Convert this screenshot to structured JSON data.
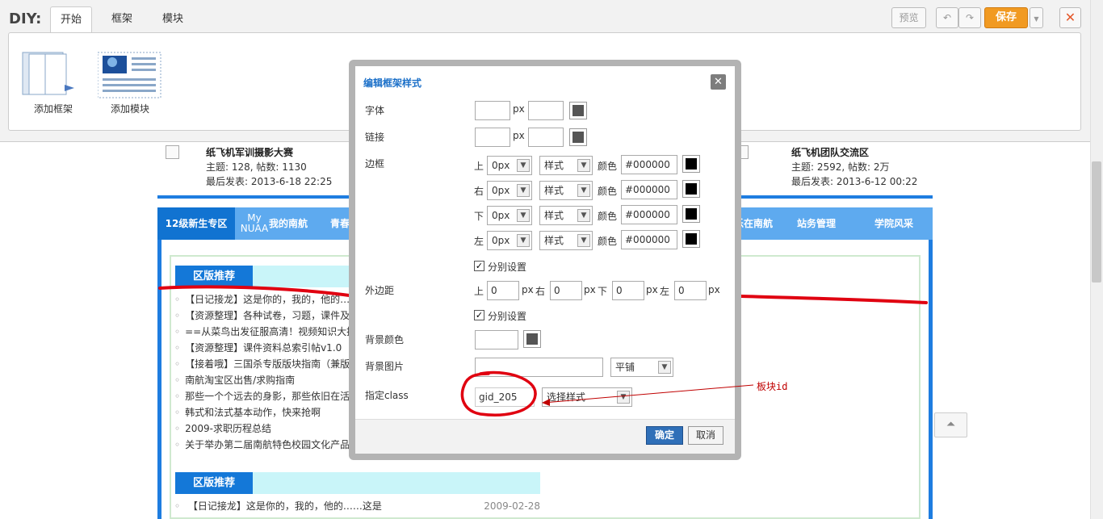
{
  "diy": {
    "label": "DIY:",
    "tabs": [
      "开始",
      "框架",
      "模块"
    ],
    "tools": {
      "add_frame": "添加框架",
      "add_module": "添加模块"
    },
    "preview": "预览",
    "undo_icon": "undo-icon",
    "redo_icon": "redo-icon",
    "save": "保存",
    "close": "✕"
  },
  "forum": {
    "left": {
      "title": "纸飞机军训摄影大赛",
      "stats": "主题: 128, 帖数: 1130",
      "last": "最后发表: 2013-6-18 22:25"
    },
    "right": {
      "title": "纸飞机团队交流区",
      "stats": "主题: 2592, 帖数: 2万",
      "last": "最后发表: 2013-6-12 00:22"
    }
  },
  "nav": {
    "items": [
      "12级新生专区",
      "My",
      "NUAA",
      "我的南航",
      "青春南",
      "乐在南航",
      "站务管理",
      "学院风采"
    ]
  },
  "sections": [
    {
      "title": "区版推荐",
      "items": [
        "【日记接龙】这是你的，我的，他的……",
        "【资源整理】各种试卷，习题，课件及资",
        "==从菜鸟出发征服高清！视频知识大拼盘",
        "【资源整理】课件资料总索引帖v1.0",
        "【接着哦】三国杀专版版块指南（兼版规",
        "南航淘宝区出售/求购指南",
        "那些一个个远去的身影，那些依旧在活跃",
        "韩式和法式基本动作，快来抢啊",
        "2009-求职历程总结",
        "关于举办第二届南航特色校园文化产品大"
      ]
    },
    {
      "title": "区版推荐",
      "items": [
        "【日记接龙】这是你的，我的，他的……这是"
      ],
      "dates": [
        "2009-02-28"
      ]
    }
  ],
  "dialog": {
    "title": "编辑框架样式",
    "labels": {
      "font": "字体",
      "link": "链接",
      "border": "边框",
      "margin": "外边距",
      "bg_color": "背景颜色",
      "bg_image": "背景图片",
      "class": "指定class"
    },
    "px": "px",
    "sides": [
      "上",
      "右",
      "下",
      "左"
    ],
    "border_width": "0px",
    "border_style": "样式",
    "color_label": "颜色",
    "border_color": "#000000",
    "separate": "分别设置",
    "margin_values": [
      "0",
      "0",
      "0",
      "0"
    ],
    "bg_repeat": "平铺",
    "class_value": "gid_205",
    "class_select": "选择样式",
    "ok": "确定",
    "cancel": "取消"
  },
  "annotation": "板块id",
  "colors": {
    "accent": "#1e7de0",
    "save": "#f19a22",
    "mark": "#e00010"
  }
}
